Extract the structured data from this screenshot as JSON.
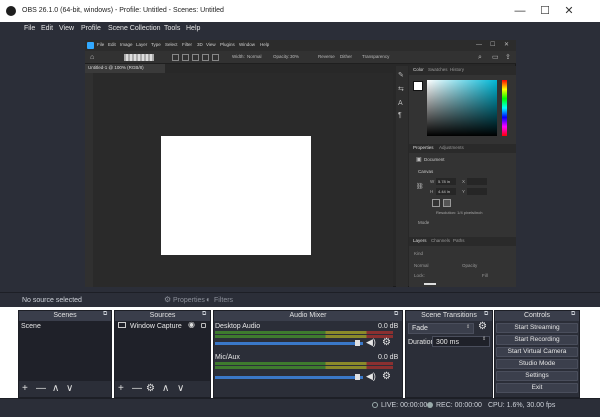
{
  "window": {
    "title": "OBS 26.1.0 (64-bit, windows) - Profile: Untitled - Scenes: Untitled",
    "minimize": "—",
    "maximize": "☐",
    "close": "✕"
  },
  "menu": [
    "File",
    "Edit",
    "View",
    "Profile",
    "Scene Collection",
    "Tools",
    "Help"
  ],
  "capture": {
    "ps_menu": [
      "File",
      "Edit",
      "Image",
      "Layer",
      "Type",
      "Select",
      "Filter",
      "3D",
      "View",
      "Plugins",
      "Window",
      "Help"
    ],
    "ps_tab": "Untitled-1 @ 100% (RGB/8)",
    "ps_options": {
      "width": "Width:",
      "width_val": "Normal",
      "opacity": "Opacity:",
      "opacity_val": "30%",
      "reverse": "Reverse",
      "dither": "Dither",
      "transparency": "Transparency"
    },
    "panels": {
      "color_tabs": [
        "Color",
        "Swatches",
        "History"
      ],
      "properties_tabs": [
        "Properties",
        "Adjustments"
      ],
      "document": "Document",
      "canvas": "Canvas",
      "w_label": "W",
      "w_val": "5.78 in",
      "h_label": "H",
      "h_val": "4.44 in",
      "x_label": "X",
      "y_label": "Y",
      "resolution": "Resolution: 1/4 pixels/inch",
      "mode": "Mode",
      "layers_tabs": [
        "Layers",
        "Channels",
        "Paths"
      ],
      "kind": "Kind",
      "normal": "Normal",
      "opacity": "Opacity",
      "lock": "Lock:",
      "fill": "Fill"
    }
  },
  "status_no_source": "No source selected",
  "toolbar_tabs": {
    "properties": "Properties",
    "filters": "Filters"
  },
  "scenes": {
    "title": "Scenes",
    "items": [
      "Scene"
    ]
  },
  "sources": {
    "title": "Sources",
    "items": [
      "Window Capture"
    ]
  },
  "mixer": {
    "title": "Audio Mixer",
    "channels": [
      {
        "name": "Desktop Audio",
        "level": "0.0 dB"
      },
      {
        "name": "Mic/Aux",
        "level": "0.0 dB"
      }
    ]
  },
  "transitions": {
    "title": "Scene Transitions",
    "type": "Fade",
    "duration_label": "Duration",
    "duration_value": "300 ms"
  },
  "controls": {
    "title": "Controls",
    "buttons": [
      "Start Streaming",
      "Start Recording",
      "Start Virtual Camera",
      "Studio Mode",
      "Settings",
      "Exit"
    ]
  },
  "status": {
    "live": "LIVE: 00:00:00",
    "rec": "REC: 00:00:00",
    "cpu": "CPU: 1.6%, 30.00 fps"
  },
  "icons": {
    "add": "+",
    "remove": "—",
    "up": "∧",
    "down": "∨",
    "gear": "⚙",
    "speaker": "🔊",
    "eye": "👁",
    "lock": "🔒"
  }
}
